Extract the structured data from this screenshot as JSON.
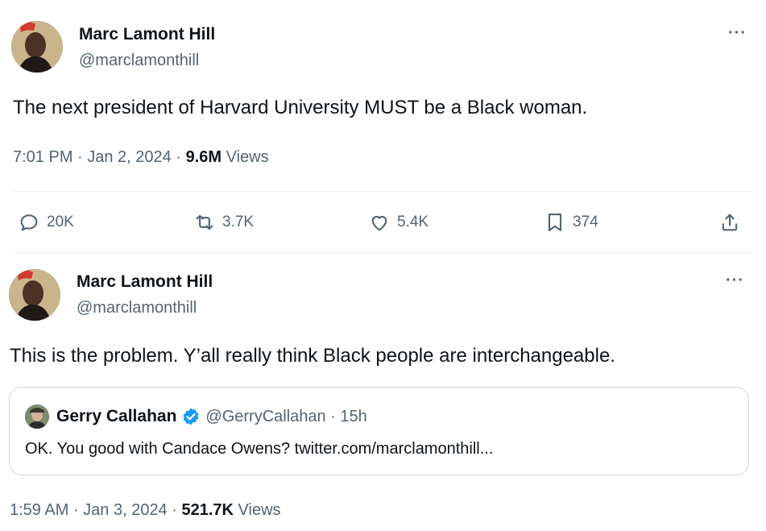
{
  "tweet1": {
    "author_name": "Marc Lamont Hill",
    "author_handle": "@marclamonthill",
    "text": "The next president of Harvard University MUST be a Black woman.",
    "time": "7:01 PM · Jan 2, 2024 ·",
    "views_count": "9.6M",
    "views_label": "Views",
    "replies": "20K",
    "retweets": "3.7K",
    "likes": "5.4K",
    "bookmarks": "374",
    "more_label": "···"
  },
  "tweet2": {
    "author_name": "Marc Lamont Hill",
    "author_handle": "@marclamonthill",
    "text": "This is the problem. Y’all really think Black people are interchangeable.",
    "more_label": "···",
    "quote": {
      "author_name": "Gerry Callahan",
      "author_handle": "@GerryCallahan · 15h",
      "text": "OK. You good with Candace Owens? twitter.com/marclamonthill..."
    },
    "time": "1:59 AM · Jan 3, 2024 ·",
    "views_count": "521.7K",
    "views_label": "Views"
  },
  "colors": {
    "text": "#0f1419",
    "secondary": "#536471",
    "verified": "#1d9bf0",
    "border": "#cfd9de"
  }
}
